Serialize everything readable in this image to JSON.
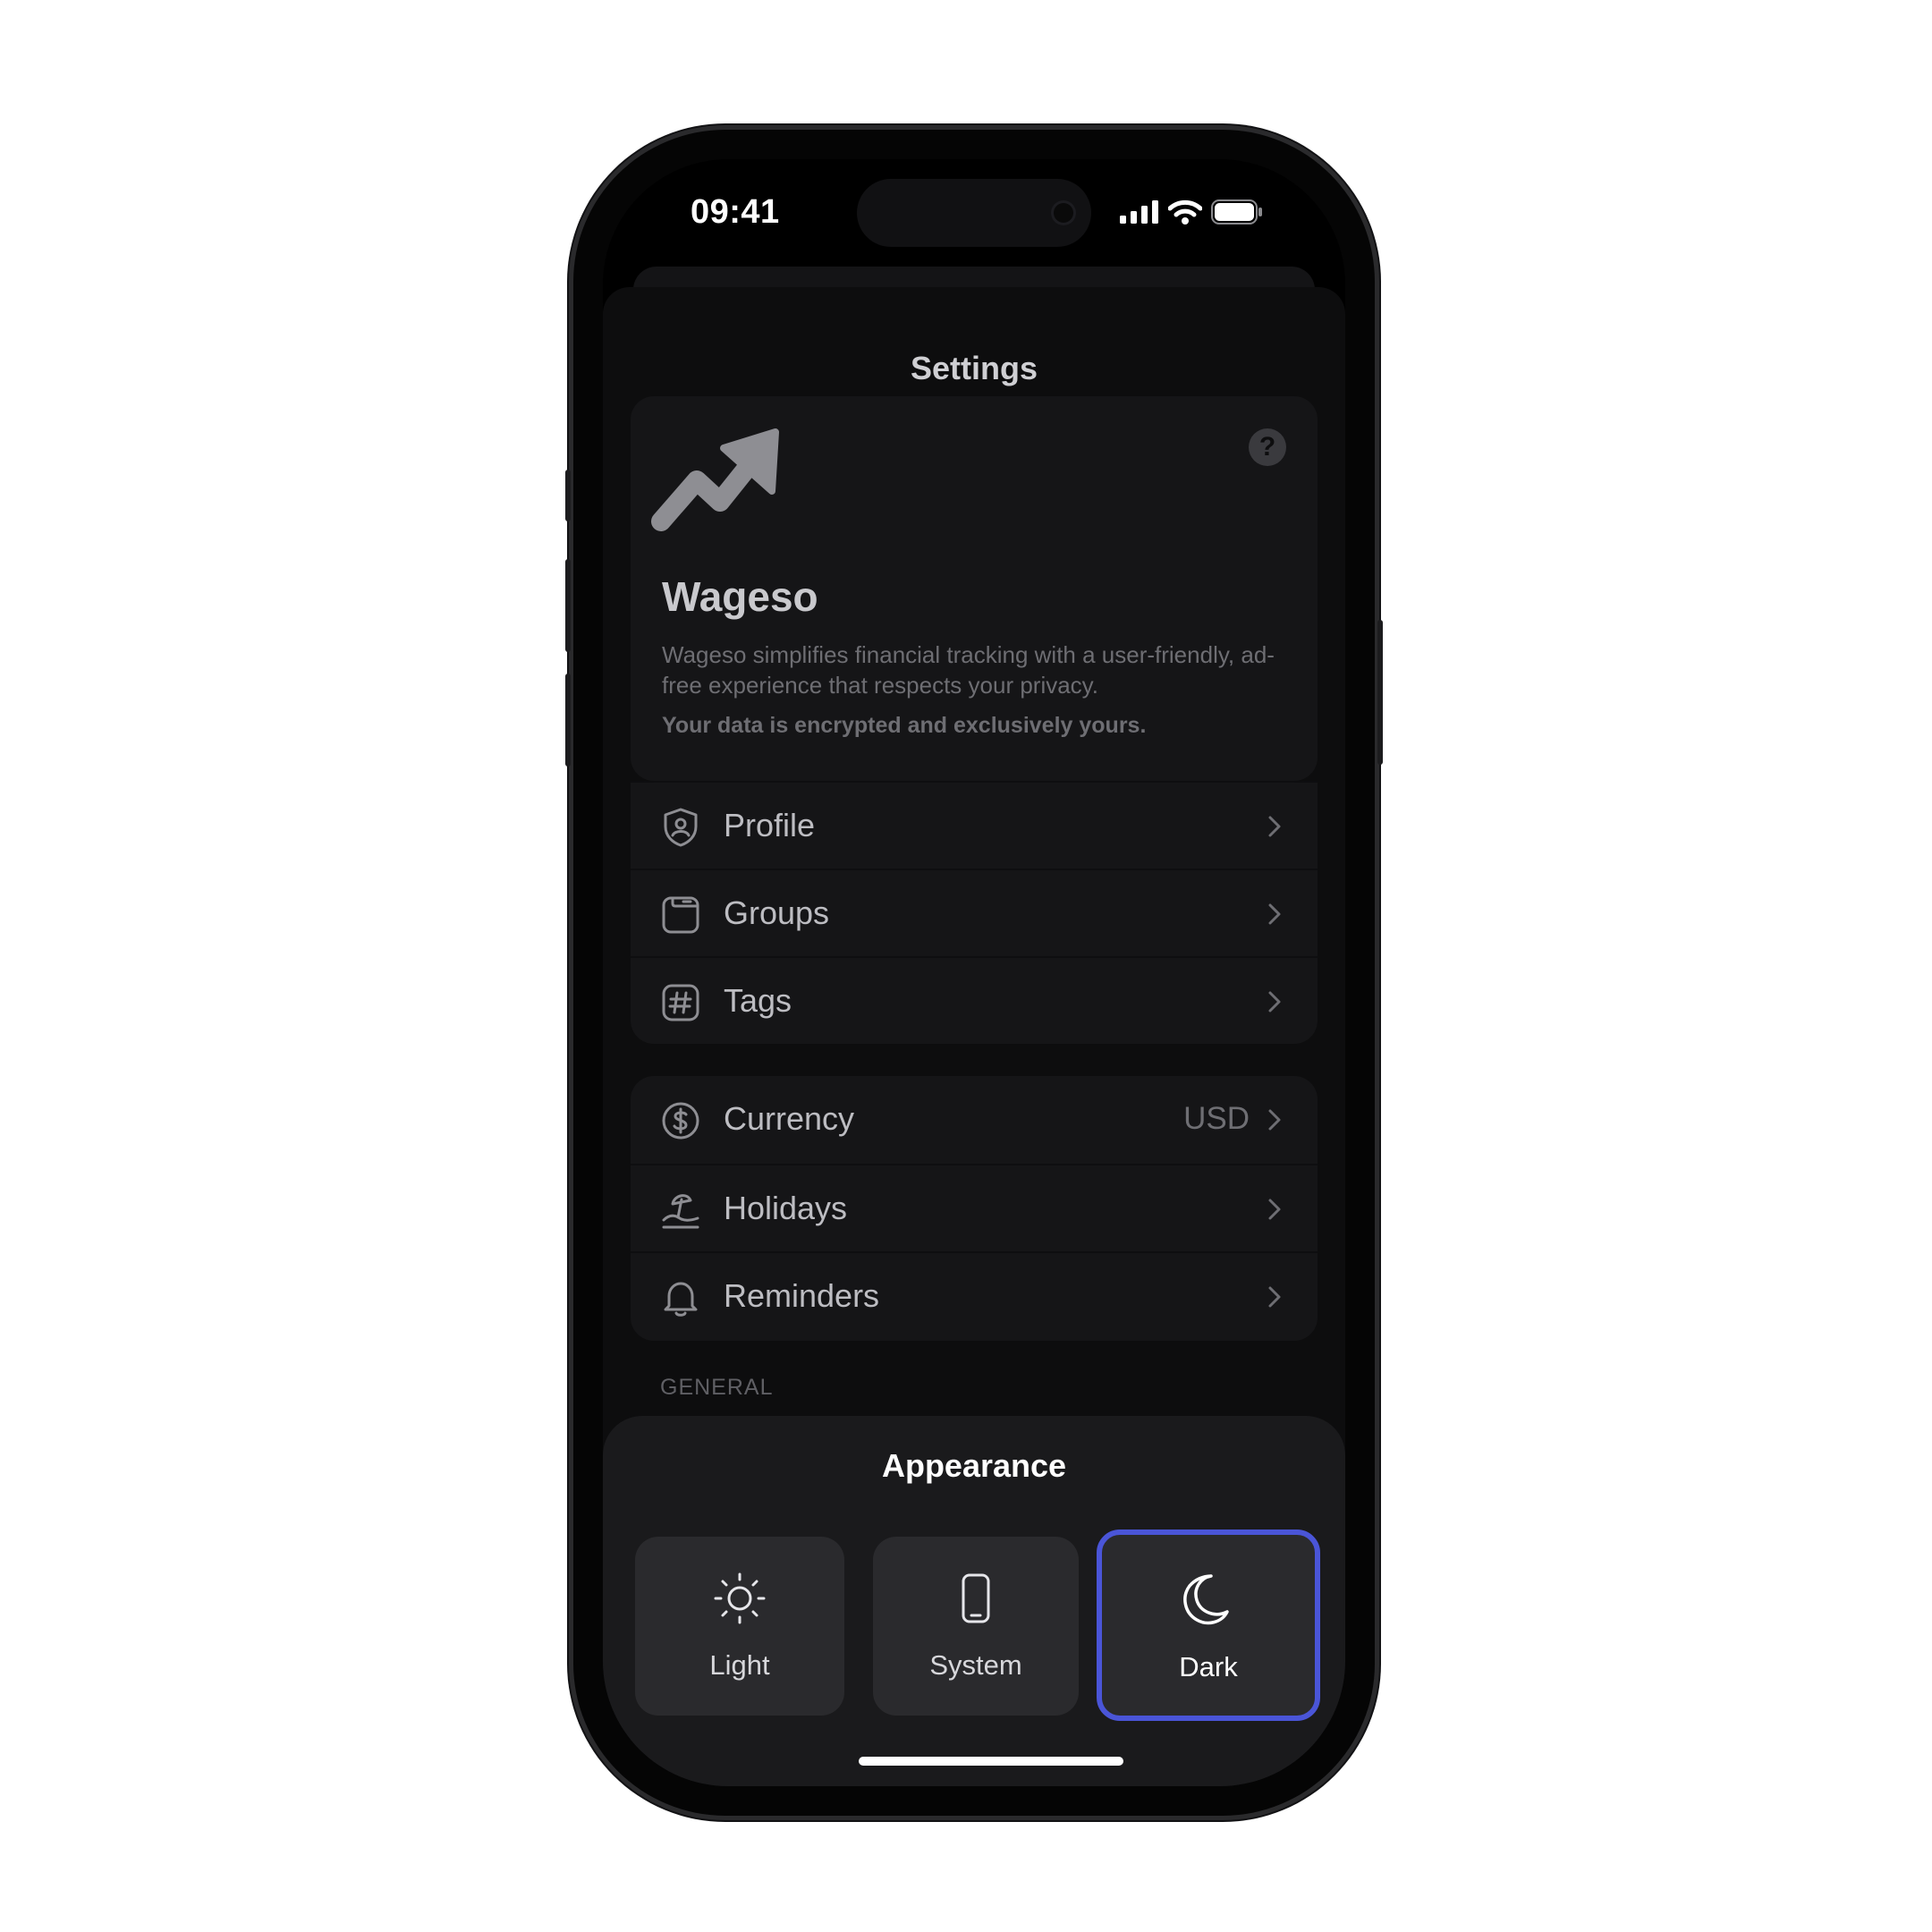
{
  "status": {
    "time": "09:41"
  },
  "sheet": {
    "title": "Settings"
  },
  "info": {
    "app_name": "Wageso",
    "description": "Wageso simplifies financial tracking with a user-friendly, ad-free experience that respects your privacy.",
    "note": "Your data is encrypted and exclusively yours.",
    "help_label": "?"
  },
  "group1": [
    {
      "label": "Profile",
      "icon": "shield-user-icon"
    },
    {
      "label": "Groups",
      "icon": "folder-icon"
    },
    {
      "label": "Tags",
      "icon": "hashtag-icon"
    }
  ],
  "group2": [
    {
      "label": "Currency",
      "icon": "dollar-circle-icon",
      "value": "USD"
    },
    {
      "label": "Holidays",
      "icon": "beach-icon"
    },
    {
      "label": "Reminders",
      "icon": "bell-icon"
    }
  ],
  "general": {
    "header": "GENERAL"
  },
  "appearance": {
    "title": "Appearance",
    "options": [
      {
        "label": "Light",
        "icon": "sun-icon"
      },
      {
        "label": "System",
        "icon": "phone-icon"
      },
      {
        "label": "Dark",
        "icon": "moon-icon"
      }
    ],
    "selected": "Dark"
  },
  "colors": {
    "accent": "#4a55d8",
    "background": "#0d0d0e",
    "card": "#151517"
  }
}
